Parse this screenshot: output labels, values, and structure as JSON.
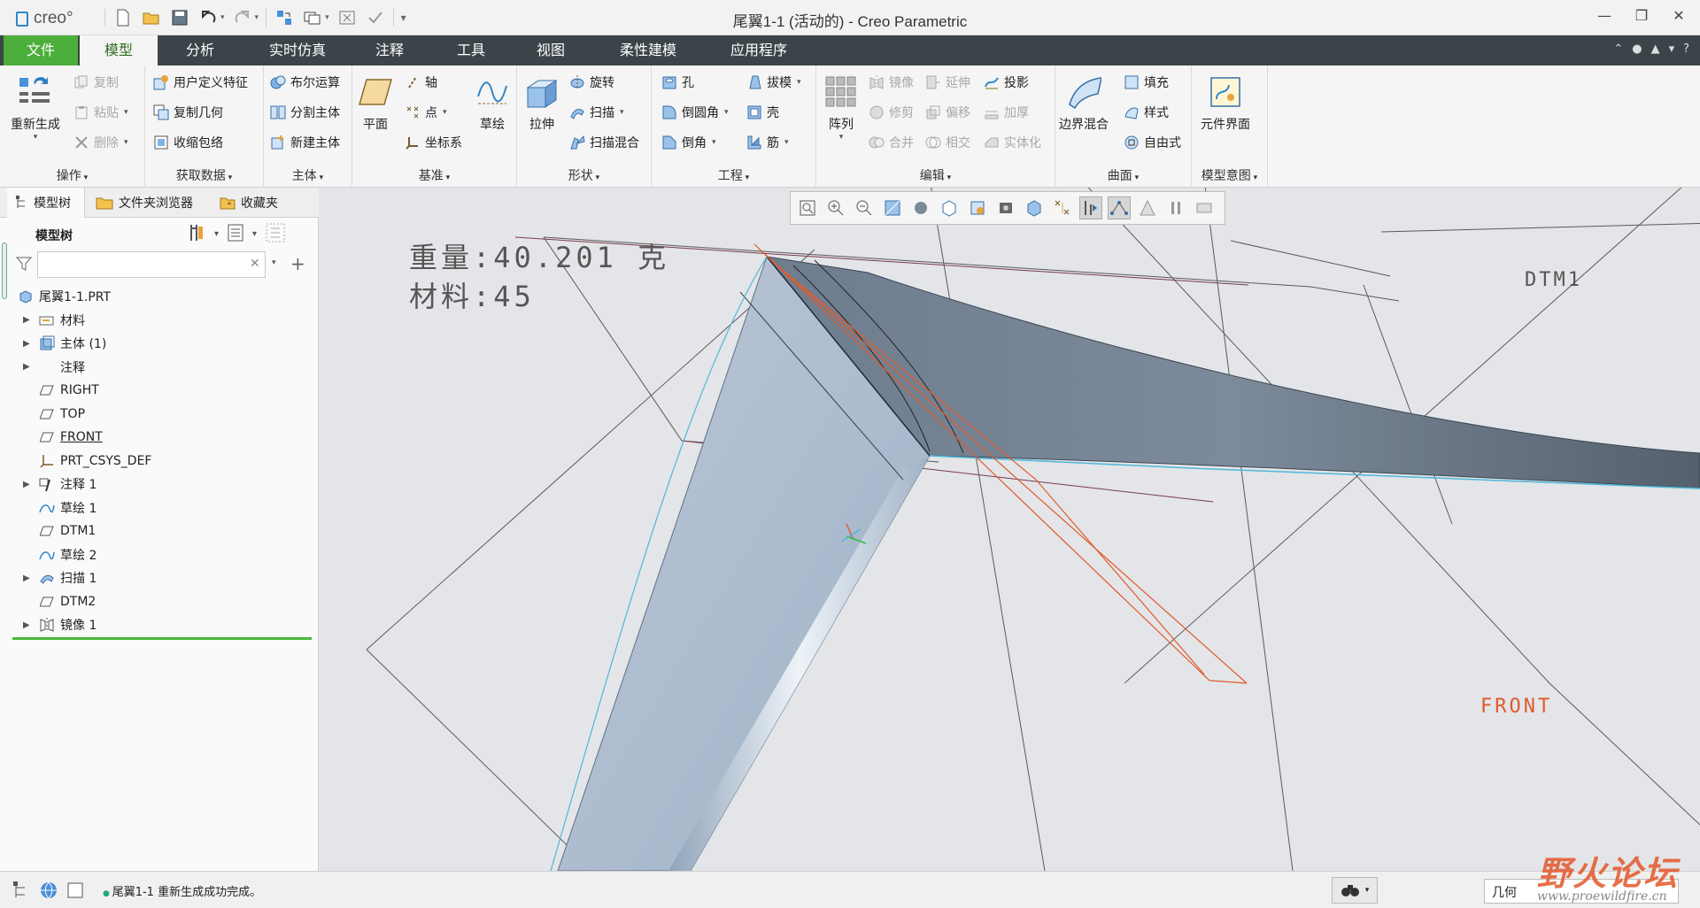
{
  "window": {
    "title": "尾翼1-1 (活动的) - Creo Parametric",
    "logo": "creo°",
    "controls": [
      "—",
      "❐",
      "✕"
    ]
  },
  "quick_access": {
    "icons": [
      "new-icon",
      "open-icon",
      "save-icon",
      "undo-icon",
      "redo-icon",
      "regenerate-icon",
      "windows-icon",
      "close-window-icon",
      "check-icon",
      "customize-icon"
    ]
  },
  "tabs": [
    "文件",
    "模型",
    "分析",
    "实时仿真",
    "注释",
    "工具",
    "视图",
    "柔性建模",
    "应用程序"
  ],
  "active_tab": "模型",
  "ribbon": {
    "operations": {
      "label": "操作",
      "regenerate": "重新生成",
      "copy": "复制",
      "paste": "粘贴",
      "delete": "删除"
    },
    "get_data": {
      "label": "获取数据",
      "udf": "用户定义特征",
      "copy_geom": "复制几何",
      "shrinkwrap": "收缩包络"
    },
    "body": {
      "label": "主体",
      "boolean": "布尔运算",
      "split_body": "分割主体",
      "new_body": "新建主体"
    },
    "datum": {
      "label": "基准",
      "plane": "平面",
      "axis": "轴",
      "point": "点",
      "csys": "坐标系",
      "sketch": "草绘"
    },
    "shapes": {
      "label": "形状",
      "extrude": "拉伸",
      "revolve": "旋转",
      "sweep": "扫描",
      "swept_blend": "扫描混合"
    },
    "engineering": {
      "label": "工程",
      "hole": "孔",
      "round": "倒圆角",
      "chamfer": "倒角",
      "draft": "拔模",
      "shell": "壳",
      "rib": "筋"
    },
    "editing": {
      "label": "编辑",
      "pattern": "阵列",
      "mirror": "镜像",
      "extend": "延伸",
      "project": "投影",
      "trim": "修剪",
      "offset": "偏移",
      "thicken": "加厚",
      "merge": "合并",
      "intersect": "相交",
      "solidify": "实体化"
    },
    "surfaces": {
      "label": "曲面",
      "boundary_blend": "边界混合",
      "fill": "填充",
      "style": "样式",
      "freestyle": "自由式"
    },
    "model_intent": {
      "label": "模型意图",
      "component_interface": "元件界面"
    }
  },
  "left_pane": {
    "tabs": [
      "模型树",
      "文件夹浏览器",
      "收藏夹"
    ],
    "header": "模型树",
    "search_placeholder": "",
    "tree": [
      {
        "label": "尾翼1-1.PRT",
        "icon": "part-icon",
        "expandable": false,
        "indent": 0
      },
      {
        "label": "材料",
        "icon": "material-icon",
        "expandable": true,
        "indent": 1
      },
      {
        "label": "主体 (1)",
        "icon": "body-icon",
        "expandable": true,
        "indent": 1
      },
      {
        "label": "注释",
        "icon": "none",
        "expandable": true,
        "indent": 1
      },
      {
        "label": "RIGHT",
        "icon": "datum-plane-icon",
        "expandable": false,
        "indent": 1
      },
      {
        "label": "TOP",
        "icon": "datum-plane-icon",
        "expandable": false,
        "indent": 1
      },
      {
        "label": "FRONT",
        "icon": "datum-plane-icon",
        "expandable": false,
        "indent": 1,
        "underline": true
      },
      {
        "label": "PRT_CSYS_DEF",
        "icon": "csys-icon",
        "expandable": false,
        "indent": 1
      },
      {
        "label": "注释 1",
        "icon": "annotation-icon",
        "expandable": true,
        "indent": 1
      },
      {
        "label": "草绘 1",
        "icon": "sketch-icon",
        "expandable": false,
        "indent": 1
      },
      {
        "label": "DTM1",
        "icon": "datum-plane-icon",
        "expandable": false,
        "indent": 1
      },
      {
        "label": "草绘 2",
        "icon": "sketch-icon",
        "expandable": false,
        "indent": 1
      },
      {
        "label": "扫描 1",
        "icon": "sweep-icon",
        "expandable": true,
        "indent": 1
      },
      {
        "label": "DTM2",
        "icon": "datum-plane-icon",
        "expandable": false,
        "indent": 1
      },
      {
        "label": "镜像 1",
        "icon": "mirror-icon",
        "expandable": true,
        "indent": 1
      }
    ]
  },
  "graphics": {
    "annotation_weight": "重量:40.201 克",
    "annotation_material": "材料:45",
    "plane_labels": {
      "dtm1": "DTM1",
      "front": "FRONT"
    },
    "view_toolbar_icons": [
      "refit-icon",
      "zoom-in-icon",
      "zoom-out-icon",
      "repaint-icon",
      "display-style-icon",
      "saved-views-icon",
      "view-manager-icon",
      "perspective-icon",
      "section-icon",
      "datum-display-icon",
      "spin-center-icon",
      "annotation-display-icon",
      "appearance-icon",
      "pause-icon",
      "animate-icon"
    ]
  },
  "status": {
    "message": "尾翼1-1 重新生成成功完成。",
    "selection_filter": "几何"
  },
  "watermark": {
    "title": "野火论坛",
    "url": "www.proewildfire.cn"
  }
}
